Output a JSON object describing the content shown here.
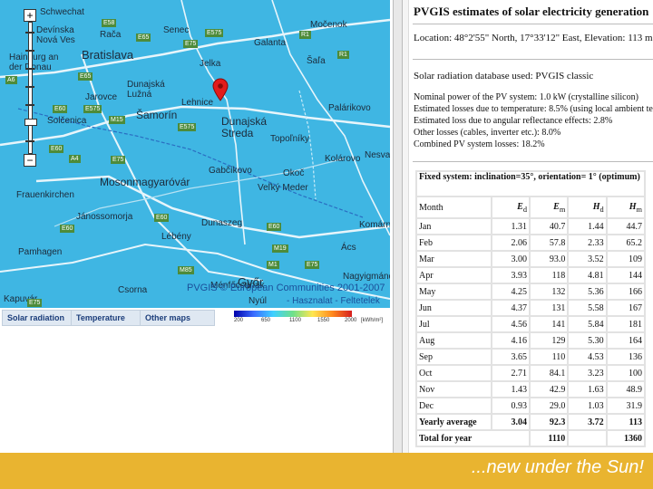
{
  "map": {
    "cities": [
      {
        "name": "Schwechat"
      },
      {
        "name": "Devínska Nová Ves"
      },
      {
        "name": "Rača"
      },
      {
        "name": "Senec"
      },
      {
        "name": "Močenok"
      },
      {
        "name": "Hainburg an der Donau"
      },
      {
        "name": "Bratislava"
      },
      {
        "name": "Galanta"
      },
      {
        "name": "Šaľa"
      },
      {
        "name": "Jelka"
      },
      {
        "name": "Dunajská Lužná"
      },
      {
        "name": "Jarovce"
      },
      {
        "name": "Šamorín"
      },
      {
        "name": "Lehnice"
      },
      {
        "name": "Dunajská Streda"
      },
      {
        "name": "Palárikovo"
      },
      {
        "name": "Solčenica"
      },
      {
        "name": "Topoľníky"
      },
      {
        "name": "Kolárovo"
      },
      {
        "name": "Mosonmagyaróvár"
      },
      {
        "name": "Gabčíkovo"
      },
      {
        "name": "Okoč"
      },
      {
        "name": "Nesvady"
      },
      {
        "name": "Veľký Meder"
      },
      {
        "name": "Frauenkirchen"
      },
      {
        "name": "Jánossomorja"
      },
      {
        "name": "Lébény"
      },
      {
        "name": "Dunaszeg"
      },
      {
        "name": "Komárno"
      },
      {
        "name": "Ács"
      },
      {
        "name": "Pamhagen"
      },
      {
        "name": "Győr"
      },
      {
        "name": "Nagyigmánd"
      },
      {
        "name": "Csorna"
      },
      {
        "name": "Ménfőcsanak"
      },
      {
        "name": "Nyúl"
      },
      {
        "name": "Kapuvár"
      }
    ],
    "roads": [
      "E58",
      "E65",
      "E75",
      "E575",
      "E575",
      "R1",
      "R1",
      "E65",
      "A6",
      "A4",
      "E60",
      "E60",
      "E575",
      "E60",
      "E75",
      "M15",
      "E60",
      "M19",
      "M1",
      "E75",
      "M85",
      "E75",
      "E60"
    ],
    "watermark": "PVGIS © European Communities 2001-2007",
    "links": {
      "map_link": "Hasznalat",
      "terms_link": "Feltetelek"
    },
    "zoom": {
      "in": "+",
      "out": "−"
    }
  },
  "tabs": [
    {
      "label": "Solar radiation"
    },
    {
      "label": "Temperature"
    },
    {
      "label": "Other maps"
    }
  ],
  "legend": {
    "ticks": [
      "200",
      "650",
      "1100",
      "1550",
      "2000"
    ],
    "unit": "[kWh/m²]"
  },
  "report": {
    "title": "PVGIS estimates of solar electricity generation",
    "location": "Location: 48°2'55\" North, 17°33'12\" East, Elevation: 113 m a.s.l.,",
    "database": "Solar radiation database used: PVGIS classic",
    "losses": [
      "Nominal power of the PV system: 1.0 kW (crystalline silicon)",
      "Estimated losses due to temperature: 8.5% (using local ambient temperature)",
      "Estimated loss due to angular reflectance effects: 2.8%",
      "Other losses (cables, inverter etc.): 8.0%",
      "Combined PV system losses: 18.2%"
    ],
    "table": {
      "caption": "Fixed system: inclination=35°, orientation= 1° (optimum)",
      "headers": {
        "month": "Month",
        "ed": "E",
        "ed_sub": "d",
        "em": "E",
        "em_sub": "m",
        "hd": "H",
        "hd_sub": "d",
        "hm": "H",
        "hm_sub": "m"
      },
      "rows": [
        {
          "month": "Jan",
          "ed": "1.31",
          "em": "40.7",
          "hd": "1.44",
          "hm": "44.7"
        },
        {
          "month": "Feb",
          "ed": "2.06",
          "em": "57.8",
          "hd": "2.33",
          "hm": "65.2"
        },
        {
          "month": "Mar",
          "ed": "3.00",
          "em": "93.0",
          "hd": "3.52",
          "hm": "109"
        },
        {
          "month": "Apr",
          "ed": "3.93",
          "em": "118",
          "hd": "4.81",
          "hm": "144"
        },
        {
          "month": "May",
          "ed": "4.25",
          "em": "132",
          "hd": "5.36",
          "hm": "166"
        },
        {
          "month": "Jun",
          "ed": "4.37",
          "em": "131",
          "hd": "5.58",
          "hm": "167"
        },
        {
          "month": "Jul",
          "ed": "4.56",
          "em": "141",
          "hd": "5.84",
          "hm": "181"
        },
        {
          "month": "Aug",
          "ed": "4.16",
          "em": "129",
          "hd": "5.30",
          "hm": "164"
        },
        {
          "month": "Sep",
          "ed": "3.65",
          "em": "110",
          "hd": "4.53",
          "hm": "136"
        },
        {
          "month": "Oct",
          "ed": "2.71",
          "em": "84.1",
          "hd": "3.23",
          "hm": "100"
        },
        {
          "month": "Nov",
          "ed": "1.43",
          "em": "42.9",
          "hd": "1.63",
          "hm": "48.9"
        },
        {
          "month": "Dec",
          "ed": "0.93",
          "em": "29.0",
          "hd": "1.03",
          "hm": "31.9"
        }
      ],
      "yearly": {
        "label": "Yearly average",
        "ed": "3.04",
        "em": "92.3",
        "hd": "3.72",
        "hm": "113"
      },
      "total": {
        "label": "Total for year",
        "em": "1110",
        "hm": "1360"
      }
    }
  },
  "footer": {
    "slogan": "...new under the Sun!"
  },
  "colors": {
    "map_sea": "#3fb6e3",
    "banner": "#e9b430",
    "roads": "#d8eef8",
    "marker": "#e31c1c"
  }
}
